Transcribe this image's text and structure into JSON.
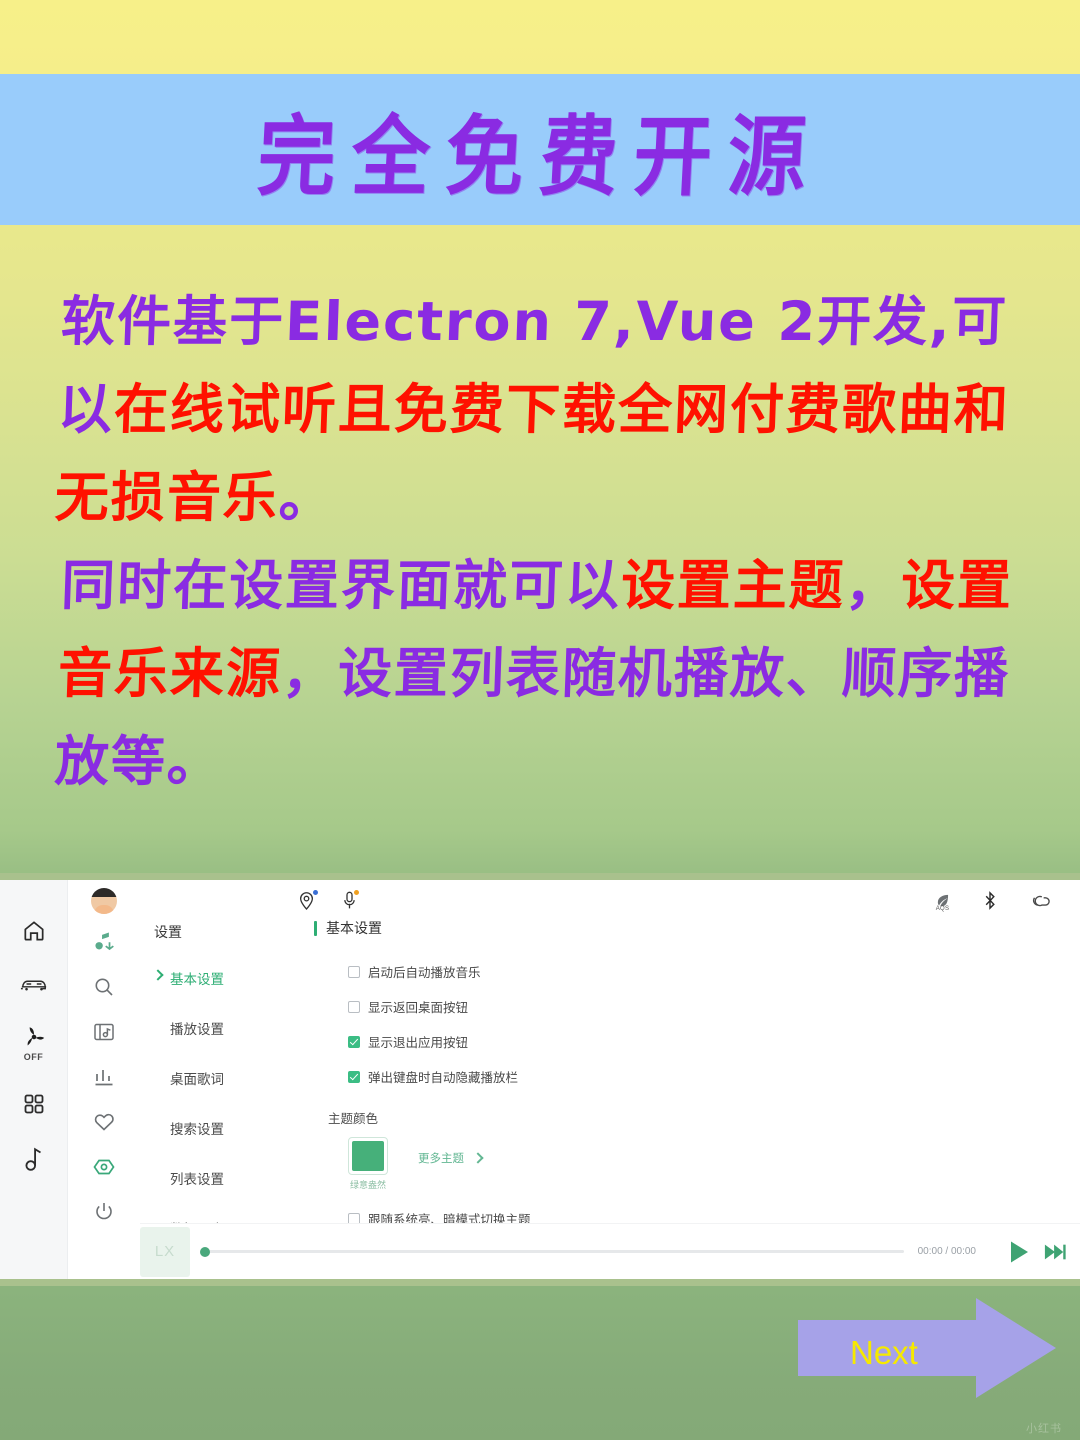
{
  "poster": {
    "title": "完全免费开源",
    "title_color": "#8a2be2",
    "title_band_color": "#99ccfb",
    "paragraph1": [
      {
        "text": "软件基于Electron 7,Vue 2开发,可以",
        "color": "purple"
      },
      {
        "text": "在线试听且免费下载全网付费歌曲和无损音乐",
        "color": "red"
      },
      {
        "text": "。",
        "color": "purple"
      }
    ],
    "paragraph2": [
      {
        "text": "同时在设置界面就可以",
        "color": "purple"
      },
      {
        "text": "设置主题",
        "color": "red"
      },
      {
        "text": "，",
        "color": "purple"
      },
      {
        "text": "设置音乐来源",
        "color": "red"
      },
      {
        "text": "，",
        "color": "purple"
      },
      {
        "text": "设置列表随机播放、顺序播放等。",
        "color": "purple"
      }
    ],
    "next_label": "Next",
    "next_label_color": "#f6e900",
    "next_arrow_color": "#a6a2e8",
    "watermark": "小红书"
  },
  "screenshot": {
    "car_rail": [
      {
        "name": "home-icon",
        "label": ""
      },
      {
        "name": "car-icon",
        "label": ""
      },
      {
        "name": "fan-icon",
        "label": "OFF"
      },
      {
        "name": "apps-grid-icon",
        "label": ""
      },
      {
        "name": "music-note-icon",
        "label": ""
      }
    ],
    "app_rail": [
      {
        "name": "avatar",
        "label": ""
      },
      {
        "name": "music-download-icon",
        "label": ""
      },
      {
        "name": "search-icon",
        "label": ""
      },
      {
        "name": "playlist-icon",
        "label": ""
      },
      {
        "name": "ranking-icon",
        "label": ""
      },
      {
        "name": "heart-icon",
        "label": ""
      },
      {
        "name": "settings-gear-icon",
        "label": ""
      },
      {
        "name": "power-icon",
        "label": ""
      }
    ],
    "status_bar": {
      "left_icons": [
        "location-pin-icon",
        "microphone-icon"
      ],
      "right_icons": [
        "aqs-leaf-icon",
        "bluetooth-icon",
        "link-icon"
      ],
      "aqs_label": "AQS"
    },
    "settings_nav": {
      "header": "设置",
      "items": [
        {
          "label": "基本设置",
          "active": true
        },
        {
          "label": "播放设置",
          "active": false
        },
        {
          "label": "桌面歌词",
          "active": false
        },
        {
          "label": "搜索设置",
          "active": false
        },
        {
          "label": "列表设置",
          "active": false
        },
        {
          "label": "数据同步",
          "active": false
        }
      ]
    },
    "settings_pane": {
      "section_title": "基本设置",
      "options": [
        {
          "label": "启动后自动播放音乐",
          "checked": false
        },
        {
          "label": "显示返回桌面按钮",
          "checked": false
        },
        {
          "label": "显示退出应用按钮",
          "checked": true
        },
        {
          "label": "弹出键盘时自动隐藏播放栏",
          "checked": true
        }
      ],
      "theme_label": "主题颜色",
      "theme_swatch_color": "#46b07a",
      "theme_swatch_name": "绿意盎然",
      "more_themes": "更多主题",
      "follow_system_label": "跟随系统亮、暗模式切换主题",
      "follow_system_checked": false
    },
    "player": {
      "cover_text": "LX",
      "time": "00:00 / 00:00",
      "play_icon": "play-icon",
      "next_icon": "next-track-icon",
      "progress_percent": 0
    }
  }
}
